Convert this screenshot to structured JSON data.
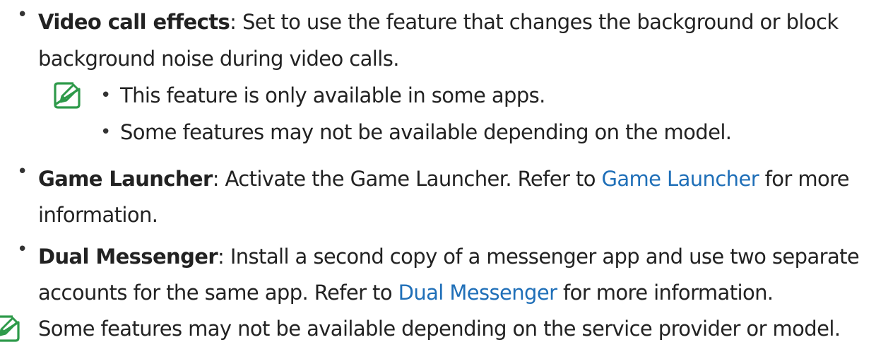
{
  "items": [
    {
      "term": "Video call effects",
      "line1": ": Set to use the feature that changes the background or block",
      "line2": "background noise during video calls."
    },
    {
      "term": "Game Launcher",
      "line1_pre": ": Activate the Game Launcher. Refer to ",
      "link": "Game Launcher",
      "line1_post": " for more",
      "line2": "information."
    },
    {
      "term": "Dual Messenger",
      "line1": ": Install a second copy of a messenger app and use two separate",
      "line2_pre": "accounts for the same app. Refer to ",
      "link": "Dual Messenger",
      "line2_post": " for more information."
    }
  ],
  "note1": [
    "This feature is only available in some apps.",
    "Some features may not be available depending on the model."
  ],
  "note2": "Some features may not be available depending on the service provider or model.",
  "colors": {
    "text": "#222222",
    "link": "#1f6fb8",
    "note_icon": "#2e9a4a"
  },
  "icons": {
    "note": "note-pencil-icon"
  }
}
